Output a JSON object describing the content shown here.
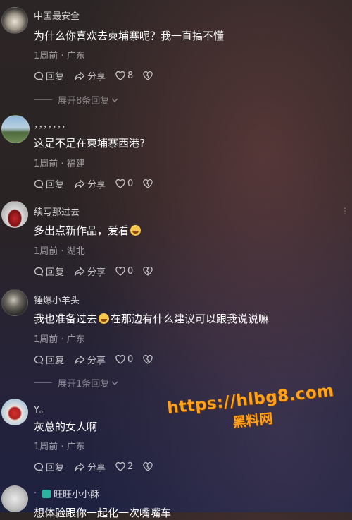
{
  "comments": [
    {
      "username": "中国最安全",
      "text": "为什么你喜欢去柬埔寨呢？我一直搞不懂",
      "time": "1周前",
      "location": "广东",
      "reply_label": "回复",
      "share_label": "分享",
      "likes": "8",
      "expand_label": "展开8条回复"
    },
    {
      "username": "，，，，，，，",
      "text": "这是不是在柬埔寨西港?",
      "time": "1周前",
      "location": "福建",
      "reply_label": "回复",
      "share_label": "分享",
      "likes": "0"
    },
    {
      "username": "续写那过去",
      "text": "多出点新作品，爱看",
      "time": "1周前",
      "location": "湖北",
      "reply_label": "回复",
      "share_label": "分享",
      "likes": "0"
    },
    {
      "username": "锤爆小羊头",
      "text_a": "我也准备过去",
      "text_b": "在那边有什么建议可以跟我说说嘛",
      "time": "1周前",
      "location": "广东",
      "reply_label": "回复",
      "share_label": "分享",
      "likes": "0",
      "expand_label": "展开1条回复"
    },
    {
      "username": "Y。",
      "text": "灰总的女人啊",
      "time": "1周前",
      "location": "广东",
      "reply_label": "回复",
      "share_label": "分享",
      "likes": "2"
    },
    {
      "username": "旺旺小小酥",
      "text": "想体验跟你一起化一次嘴嘴车"
    }
  ],
  "meta_separator": "·",
  "watermark": {
    "url": "https://hlbg8.com",
    "name": "黑料网"
  },
  "colors": {
    "watermark": "#ffa21a"
  }
}
